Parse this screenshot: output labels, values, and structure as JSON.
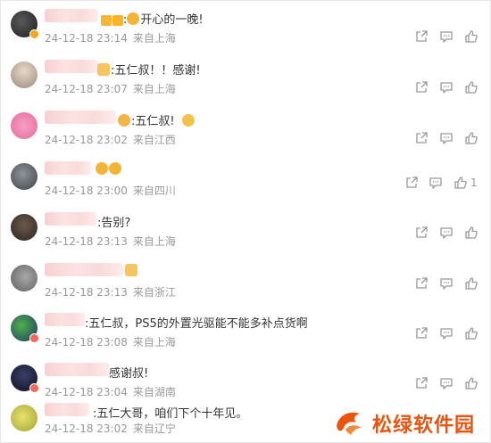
{
  "comments": [
    {
      "separator": ":",
      "text": "开心的一晚!",
      "time": "24-12-18 23:14",
      "location": "来自上海",
      "likes": ""
    },
    {
      "separator": ":",
      "text": "五仁叔！！感谢!",
      "time": "24-12-18 23:07",
      "location": "来自上海",
      "likes": ""
    },
    {
      "separator": ":",
      "text": "五仁叔!",
      "time": "24-12-18 23:02",
      "location": "来自江西",
      "likes": ""
    },
    {
      "separator": "",
      "text": "",
      "time": "24-12-18 23:00",
      "location": "来自四川",
      "likes": "1"
    },
    {
      "separator": ":",
      "text": "告别?",
      "time": "24-12-18 23:13",
      "location": "来自上海",
      "likes": ""
    },
    {
      "separator": "",
      "text": "",
      "time": "24-12-18 23:13",
      "location": "来自浙江",
      "likes": ""
    },
    {
      "separator": ":",
      "text": "五仁叔，PS5的外置光驱能不能多补点货啊",
      "time": "24-12-18 23:08",
      "location": "来自上海",
      "likes": ""
    },
    {
      "separator": "",
      "text": "感谢叔!",
      "time": "24-12-18 23:04",
      "location": "来自湖南",
      "likes": ""
    },
    {
      "separator": ":",
      "text": "五仁大哥，咱们下个十年见。",
      "time": "24-12-18 23:02",
      "location": "来自辽宁",
      "likes": ""
    }
  ],
  "icons": {
    "share": "share-icon",
    "comment": "comment-icon",
    "like": "thumbs-up-icon"
  },
  "watermark": {
    "text": "松绿软件园"
  },
  "colors": {
    "meta": "#999999",
    "text": "#333333",
    "watermark": "#e9540f"
  }
}
